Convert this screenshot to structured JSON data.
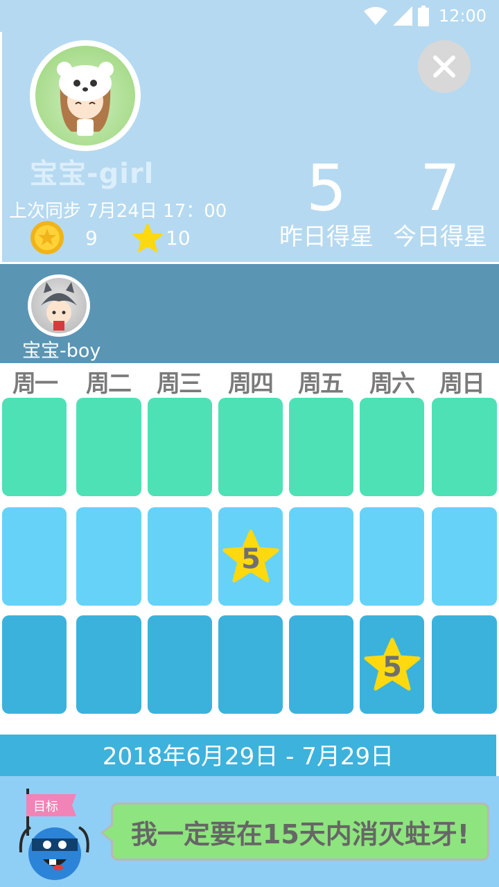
{
  "status_bar": {
    "time": "12:00",
    "icons": [
      "wifi-icon",
      "signal-icon",
      "battery-icon"
    ]
  },
  "profile": {
    "name": "宝宝-girl",
    "last_sync": "上次同步  7月24日  17：00",
    "coins": "9",
    "stars": "10",
    "yesterday_stars": "5",
    "yesterday_label": "昨日得星",
    "today_stars": "7",
    "today_label": "今日得星"
  },
  "child_switch": {
    "name": "宝宝-boy"
  },
  "weekdays": [
    "周一",
    "周二",
    "周三",
    "周四",
    "周五",
    "周六",
    "周日"
  ],
  "week_rows": [
    {
      "color": "#4fe1b6",
      "stars": [
        null,
        null,
        null,
        null,
        null,
        null,
        null
      ]
    },
    {
      "color": "#67d2f8",
      "stars": [
        null,
        null,
        null,
        "5",
        null,
        null,
        null
      ]
    },
    {
      "color": "#3bb2dc",
      "stars": [
        null,
        null,
        null,
        null,
        null,
        "5",
        null
      ]
    }
  ],
  "date_range": "2018年6月29日 - 7月29日",
  "goal": {
    "flag_label": "目标",
    "text": "我一定要在15天内消灭蛀牙!"
  },
  "colors": {
    "header_bg": "#b5d9f0",
    "boy_bar_bg": "#5a95b4",
    "star_yellow": "#ffd90f",
    "bubble_bg": "#8ee47e"
  }
}
